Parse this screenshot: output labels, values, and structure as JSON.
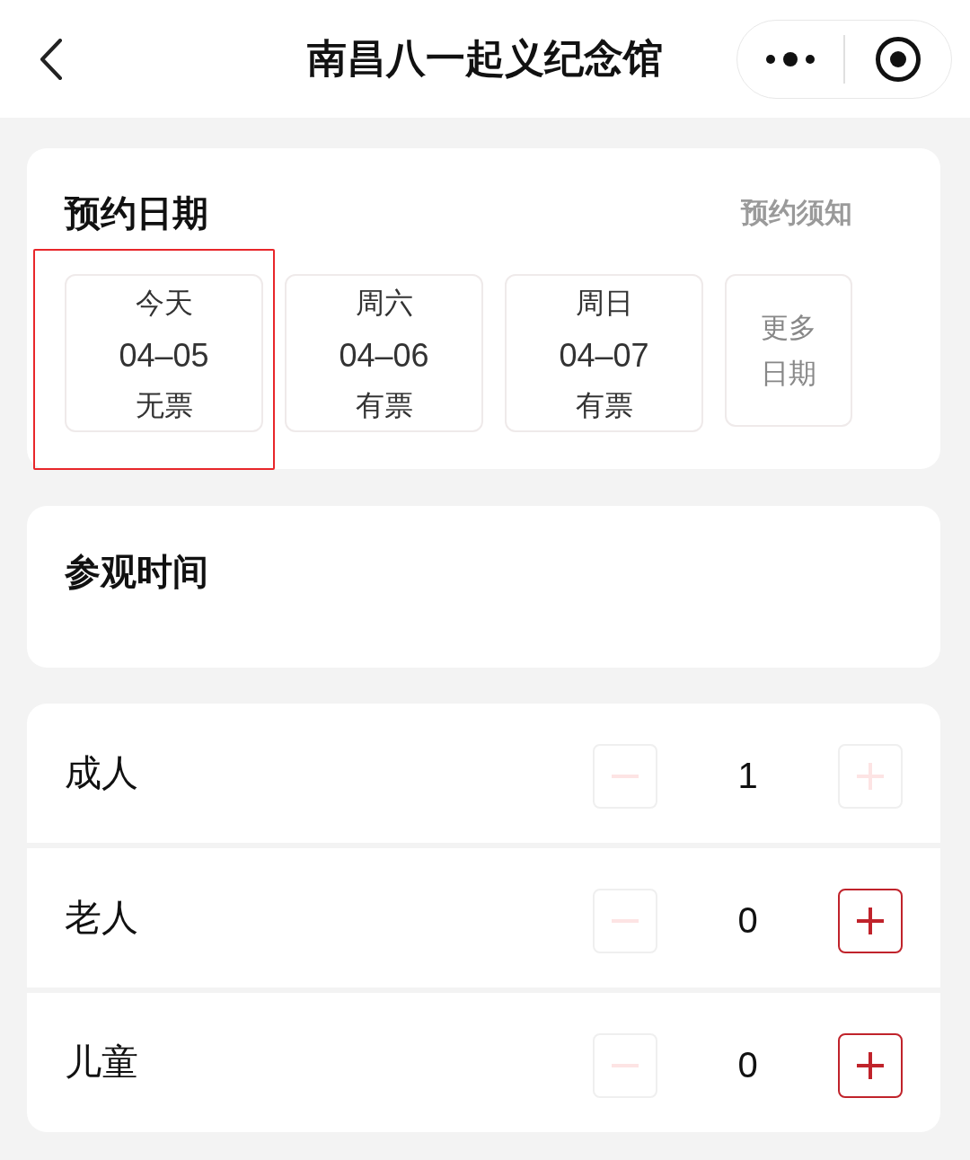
{
  "nav_bar": {
    "title": "南昌八一起义纪念馆"
  },
  "date_section": {
    "title": "预约日期",
    "notice_link": "预约须知",
    "options": [
      {
        "kind": "day",
        "day": "今天",
        "date": "04–05",
        "availability": "无票",
        "selected": false,
        "highlighted": true
      },
      {
        "kind": "day",
        "day": "周六",
        "date": "04–06",
        "availability": "有票",
        "selected": false,
        "highlighted": false
      },
      {
        "kind": "day",
        "day": "周日",
        "date": "04–07",
        "availability": "有票",
        "selected": false,
        "highlighted": false
      },
      {
        "kind": "more",
        "label": "更多日期",
        "selected": false,
        "highlighted": false
      }
    ]
  },
  "time_section": {
    "title": "参观时间"
  },
  "tickets": [
    {
      "label": "成人",
      "count": "1",
      "minus": {
        "disabled": true
      },
      "plus": {
        "disabled": true
      }
    },
    {
      "label": "老人",
      "count": "0",
      "minus": {
        "disabled": true
      },
      "plus": {
        "disabled": false
      }
    },
    {
      "label": "儿童",
      "count": "0",
      "minus": {
        "disabled": true
      },
      "plus": {
        "disabled": false
      }
    }
  ]
}
